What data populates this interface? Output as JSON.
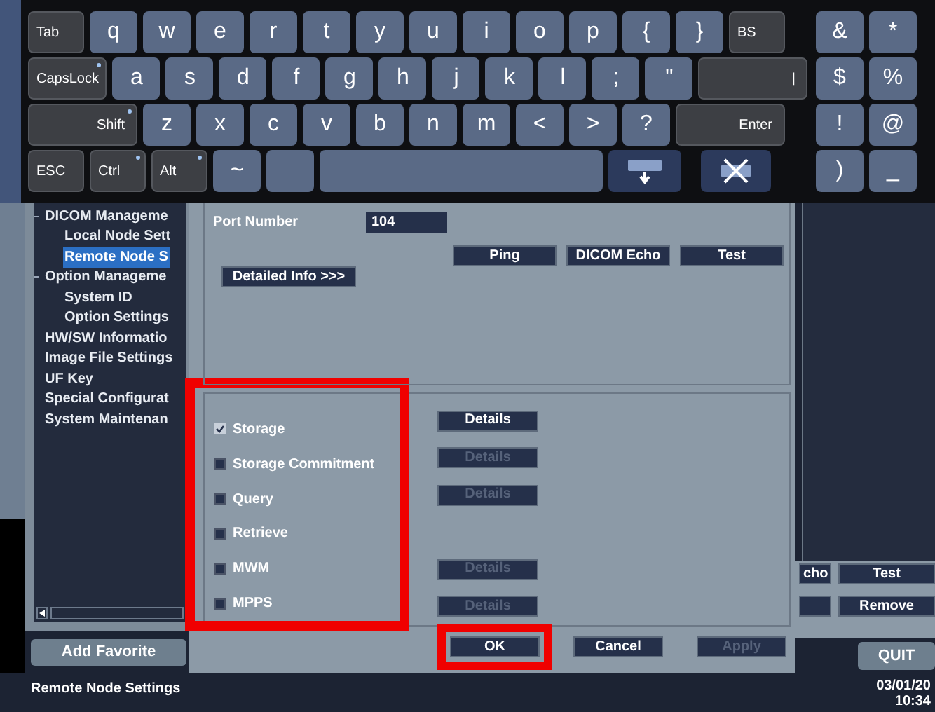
{
  "keyboard": {
    "top_row": [
      {
        "label": "Tab",
        "kind": "mod"
      },
      {
        "label": "q",
        "kind": "char"
      },
      {
        "label": "w",
        "kind": "char"
      },
      {
        "label": "e",
        "kind": "char"
      },
      {
        "label": "r",
        "kind": "char"
      },
      {
        "label": "t",
        "kind": "char"
      },
      {
        "label": "y",
        "kind": "char"
      },
      {
        "label": "u",
        "kind": "char"
      },
      {
        "label": "i",
        "kind": "char"
      },
      {
        "label": "o",
        "kind": "char"
      },
      {
        "label": "p",
        "kind": "char"
      },
      {
        "label": "{",
        "kind": "char"
      },
      {
        "label": "}",
        "kind": "char"
      },
      {
        "label": "BS",
        "kind": "mod"
      }
    ],
    "home_row": [
      {
        "label": "CapsLock",
        "kind": "mod",
        "indicator": true
      },
      {
        "label": "a",
        "kind": "char"
      },
      {
        "label": "s",
        "kind": "char"
      },
      {
        "label": "d",
        "kind": "char"
      },
      {
        "label": "f",
        "kind": "char"
      },
      {
        "label": "g",
        "kind": "char"
      },
      {
        "label": "h",
        "kind": "char"
      },
      {
        "label": "j",
        "kind": "char"
      },
      {
        "label": "k",
        "kind": "char"
      },
      {
        "label": "l",
        "kind": "char"
      },
      {
        "label": ";",
        "kind": "char"
      },
      {
        "label": "\"",
        "kind": "char"
      },
      {
        "label": "|",
        "kind": "wide"
      }
    ],
    "shift_row": [
      {
        "label": "Shift",
        "kind": "wide",
        "indicator": true
      },
      {
        "label": "z",
        "kind": "char"
      },
      {
        "label": "x",
        "kind": "char"
      },
      {
        "label": "c",
        "kind": "char"
      },
      {
        "label": "v",
        "kind": "char"
      },
      {
        "label": "b",
        "kind": "char"
      },
      {
        "label": "n",
        "kind": "char"
      },
      {
        "label": "m",
        "kind": "char"
      },
      {
        "label": "<",
        "kind": "char"
      },
      {
        "label": ">",
        "kind": "char"
      },
      {
        "label": "?",
        "kind": "char"
      },
      {
        "label": "Enter",
        "kind": "wide"
      }
    ],
    "bottom_row": [
      {
        "label": "ESC",
        "kind": "mod"
      },
      {
        "label": "Ctrl",
        "kind": "mod",
        "indicator": true
      },
      {
        "label": "Alt",
        "kind": "mod",
        "indicator": true
      },
      {
        "label": "~",
        "kind": "char"
      },
      {
        "kind": "blank"
      },
      {
        "kind": "space"
      },
      {
        "kind": "hide"
      },
      {
        "kind": "close"
      }
    ],
    "symbol_pad": [
      [
        "&",
        "*"
      ],
      [
        "$",
        "%"
      ],
      [
        "!",
        "@"
      ],
      [
        ")",
        "_"
      ]
    ]
  },
  "tree": {
    "items": [
      {
        "label": "DICOM Manageme",
        "expanded": true,
        "selected": false,
        "children": [
          {
            "label": "Local Node Sett",
            "selected": false
          },
          {
            "label": "Remote Node S",
            "selected": true
          }
        ]
      },
      {
        "label": "Option Manageme",
        "expanded": true,
        "selected": false,
        "children": [
          {
            "label": "System ID",
            "selected": false
          },
          {
            "label": "Option Settings",
            "selected": false
          }
        ]
      },
      {
        "label": "HW/SW Informatio",
        "selected": false
      },
      {
        "label": "Image File Settings",
        "selected": false
      },
      {
        "label": "UF Key",
        "selected": false
      },
      {
        "label": "Special Configurat",
        "selected": false
      },
      {
        "label": "System Maintenan",
        "selected": false
      }
    ]
  },
  "add_favorite": "Add Favorite",
  "dialog": {
    "port_label": "Port Number",
    "port_value": "104",
    "upper_buttons": [
      "Ping",
      "DICOM Echo",
      "Test"
    ],
    "detail_button": "Detailed Info >>>",
    "services_highlighted": true,
    "services": [
      {
        "label": "Storage",
        "checked": true,
        "details": {
          "label": "Details",
          "disabled": false
        }
      },
      {
        "label": "Storage Commitment",
        "checked": false,
        "details": {
          "label": "Details",
          "disabled": true
        }
      },
      {
        "label": "Query",
        "checked": false,
        "details": {
          "label": "Details",
          "disabled": true
        }
      },
      {
        "label": "Retrieve",
        "checked": false
      },
      {
        "label": "MWM",
        "checked": false,
        "details": {
          "label": "Details",
          "disabled": true
        }
      },
      {
        "label": "MPPS",
        "checked": false,
        "details": {
          "label": "Details",
          "disabled": true
        }
      }
    ],
    "buttons": [
      {
        "label": "OK",
        "disabled": false,
        "highlighted": true
      },
      {
        "label": "Cancel",
        "disabled": false,
        "highlighted": false
      },
      {
        "label": "Apply",
        "disabled": true,
        "highlighted": false
      }
    ]
  },
  "right_panel": {
    "echo_button": "cho",
    "test_button": "Test",
    "remove_button": "Remove"
  },
  "quit": "QUIT",
  "status": {
    "text": "Remote Node Settings",
    "date": "03/01/20",
    "time": "10:34"
  }
}
